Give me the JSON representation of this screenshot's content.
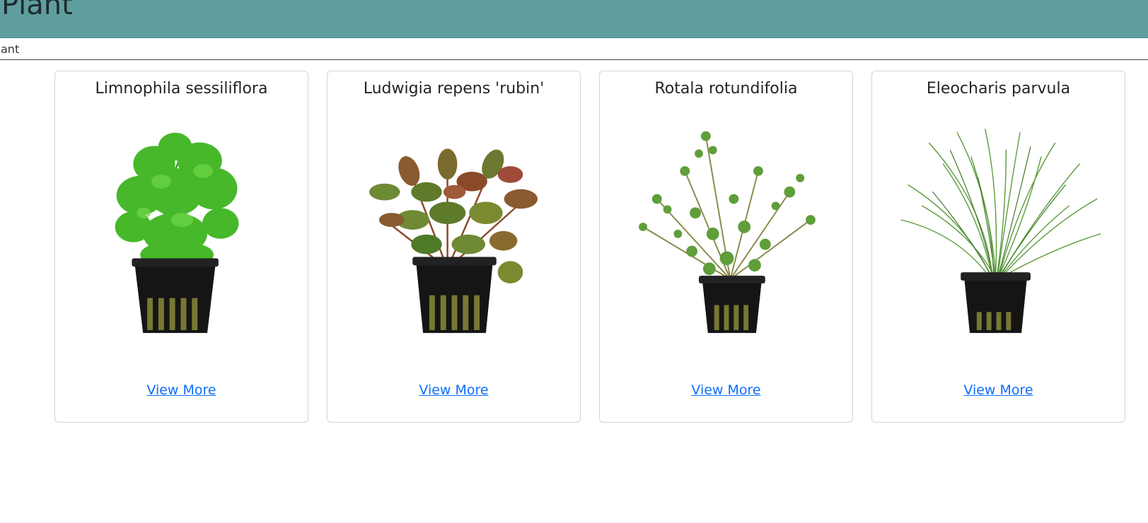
{
  "header": {
    "title": "Plant"
  },
  "search": {
    "value": "ant"
  },
  "cards": [
    {
      "title": "Limnophila sessiliflora",
      "link": "View More"
    },
    {
      "title": "Ludwigia repens 'rubin'",
      "link": "View More"
    },
    {
      "title": "Rotala rotundifolia",
      "link": "View More"
    },
    {
      "title": "Eleocharis parvula",
      "link": "View More"
    }
  ],
  "colors": {
    "header_bg": "#5f9ea0",
    "link": "#0d6efd",
    "card_border": "#d4d4d4",
    "pot": "#151515"
  }
}
